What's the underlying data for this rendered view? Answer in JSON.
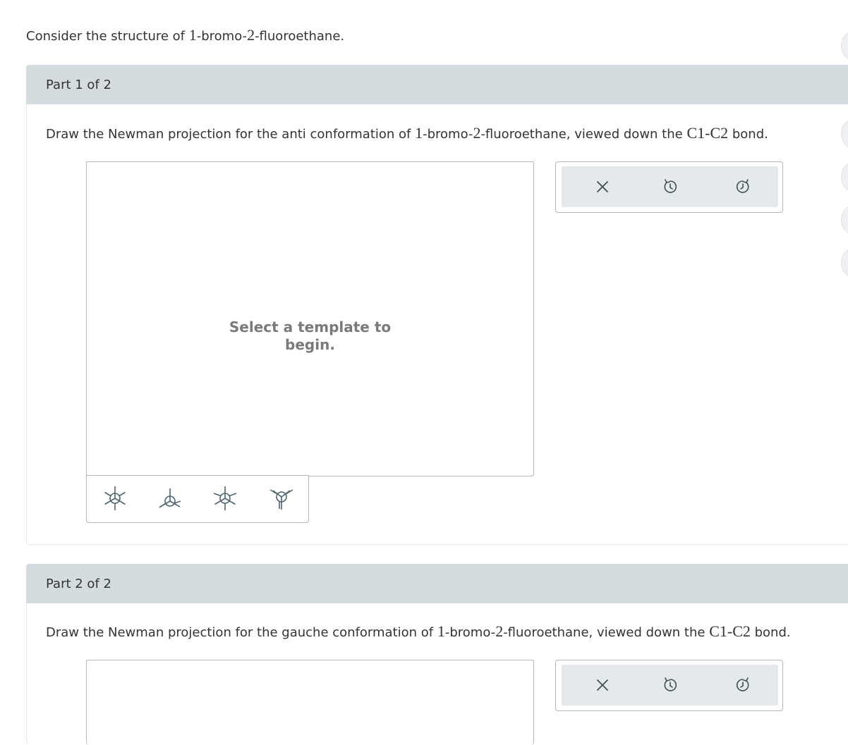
{
  "intro": {
    "text_before": "Consider the structure of ",
    "compound_num1": "1",
    "compound_dash1": "-bromo-",
    "compound_num2": "2",
    "compound_suffix": "-fluoroethane."
  },
  "part1": {
    "header": "Part 1 of 2",
    "prompt_before": "Draw the Newman projection for the anti conformation of ",
    "num1": "1",
    "mid1": "-bromo-",
    "num2": "2",
    "mid2": "-fluoroethane, viewed down the ",
    "bond": "C1-C2",
    "prompt_after": " bond.",
    "canvas_placeholder": "Select a template to begin."
  },
  "part2": {
    "header": "Part 2 of 2",
    "prompt_before": "Draw the Newman projection for the gauche conformation of ",
    "num1": "1",
    "mid1": "-bromo-",
    "num2": "2",
    "mid2": "-fluoroethane, viewed down the ",
    "bond": "C1-C2",
    "prompt_after": " bond."
  },
  "templates": [
    {
      "icon": "newman-staggered-icon"
    },
    {
      "icon": "newman-staggered-alt-icon"
    },
    {
      "icon": "newman-eclipsed-icon"
    },
    {
      "icon": "newman-eclipsed-alt-icon"
    }
  ],
  "toolbar": {
    "icons": [
      "close-icon",
      "undo-icon",
      "redo-icon"
    ]
  },
  "colors": {
    "header_bg": "#d5dce0",
    "toolbar_bg": "#e4e9ec",
    "template_stroke": "#4e6470",
    "text": "#333333",
    "placeholder": "#7a7a7a"
  }
}
